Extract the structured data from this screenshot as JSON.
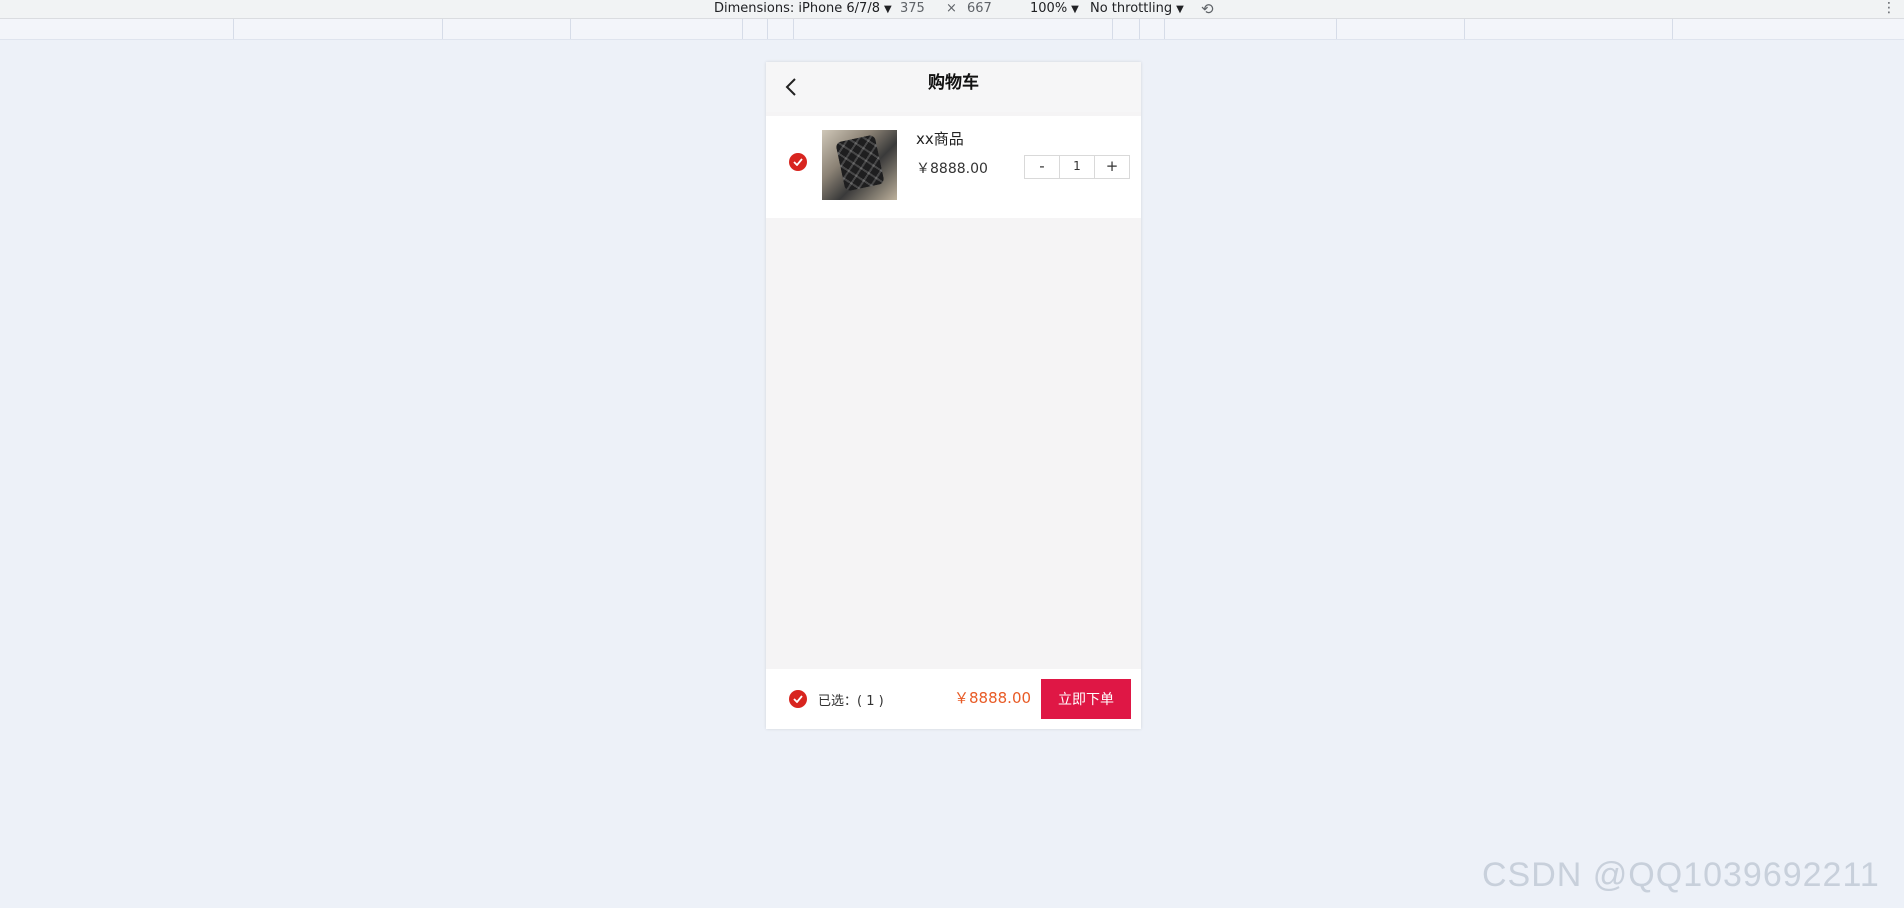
{
  "devtools": {
    "dimensions_label": "Dimensions: iPhone 6/7/8",
    "width_value": "375",
    "times_sign": "×",
    "height_value": "667",
    "zoom": "100%",
    "throttling": "No throttling"
  },
  "navbar": {
    "back_icon": "chevron-left-icon",
    "title": "购物车"
  },
  "cart": {
    "items": [
      {
        "name": "xx商品",
        "price": "￥8888.00",
        "quantity": "1",
        "checked": true
      }
    ],
    "stepper": {
      "minus": "-",
      "plus": "+"
    }
  },
  "footer": {
    "selected_label": "已选：( 1 )",
    "total": "￥8888.00",
    "order_button": "立即下单"
  },
  "watermark": "CSDN @QQ1039692211",
  "colors": {
    "accent_red": "#d8251f",
    "order_button": "#df1745",
    "price_orange": "#e85b26"
  }
}
